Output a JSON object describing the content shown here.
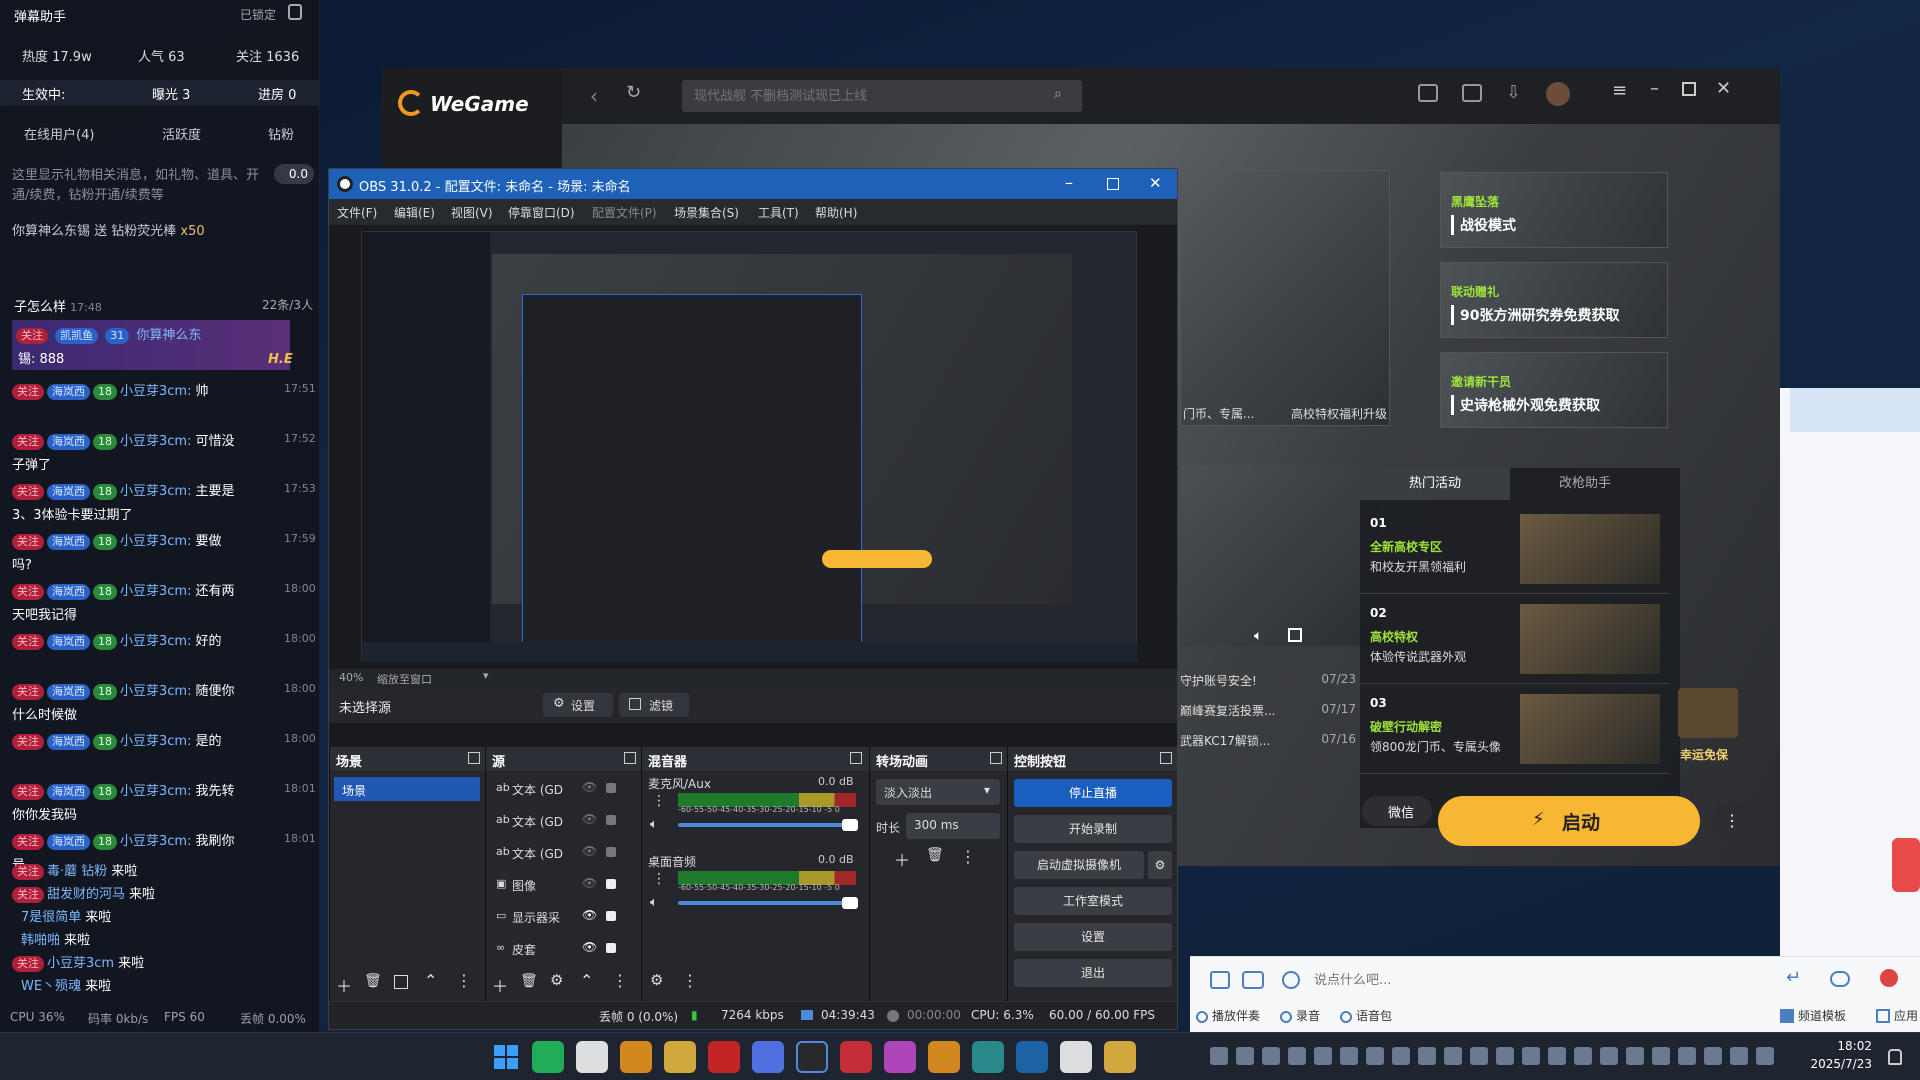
{
  "danmaku": {
    "title": "弹幕助手",
    "lock": "已锁定",
    "stats": {
      "hot": "热度 17.9w",
      "pop": "人气 63",
      "follow": "关注 1636"
    },
    "effect": {
      "active": "生效中:",
      "exposure": "曝光 3",
      "enter": "进房 0"
    },
    "header_cols": {
      "online": "在线用户(4)",
      "active": "活跃度",
      "diamond": "钻粉"
    },
    "gift_notice": "这里显示礼物相关消息，如礼物、道具、开通/续费，钻粉开通/续费等",
    "gift_count": "0.0",
    "gift_line": "你算神么东锡 送 钻粉荧光棒",
    "gift_qty": "x50",
    "chat_head": "子怎么样",
    "chat_head_time": "17:48",
    "chat_stat": "22条/3人",
    "pinned": {
      "follow": "关注",
      "fan": "凯凯鱼",
      "lv": "31",
      "name": "你算神么东",
      "text": "锡: 888"
    },
    "rows": [
      {
        "follow": "关注",
        "fan": "海岚西",
        "lv": "18",
        "name": "小豆芽3cm:",
        "text": "帅",
        "time": "17:51",
        "cont": ""
      },
      {
        "follow": "关注",
        "fan": "海岚西",
        "lv": "18",
        "name": "小豆芽3cm:",
        "text": "可惜没",
        "time": "17:52",
        "cont": "子弹了"
      },
      {
        "follow": "关注",
        "fan": "海岚西",
        "lv": "18",
        "name": "小豆芽3cm:",
        "text": "主要是",
        "time": "17:53",
        "cont": "3、3体验卡要过期了"
      },
      {
        "follow": "关注",
        "fan": "海岚西",
        "lv": "18",
        "name": "小豆芽3cm:",
        "text": "要做",
        "time": "17:59",
        "cont": "吗?"
      },
      {
        "follow": "关注",
        "fan": "海岚西",
        "lv": "18",
        "name": "小豆芽3cm:",
        "text": "还有两",
        "time": "18:00",
        "cont": "天吧我记得"
      },
      {
        "follow": "关注",
        "fan": "海岚西",
        "lv": "18",
        "name": "小豆芽3cm:",
        "text": "好的",
        "time": "18:00",
        "cont": ""
      },
      {
        "follow": "关注",
        "fan": "海岚西",
        "lv": "18",
        "name": "小豆芽3cm:",
        "text": "随便你",
        "time": "18:00",
        "cont": "什么时候做"
      },
      {
        "follow": "关注",
        "fan": "海岚西",
        "lv": "18",
        "name": "小豆芽3cm:",
        "text": "是的",
        "time": "18:00",
        "cont": ""
      },
      {
        "follow": "关注",
        "fan": "海岚西",
        "lv": "18",
        "name": "小豆芽3cm:",
        "text": "我先转",
        "time": "18:01",
        "cont": "你你发我码"
      },
      {
        "follow": "关注",
        "fan": "海岚西",
        "lv": "18",
        "name": "小豆芽3cm:",
        "text": "我刷你",
        "time": "18:01",
        "cont": "号"
      }
    ],
    "enter": [
      {
        "tag": "关注",
        "name": "毒·蘑 钻粉",
        "text": "来啦"
      },
      {
        "tag": "关注",
        "name": "甜发财的河马",
        "text": "来啦"
      },
      {
        "tag": "",
        "name": "7是很简单",
        "text": "来啦"
      },
      {
        "tag": "",
        "name": "韩啪啪",
        "text": "来啦"
      },
      {
        "tag": "关注",
        "name": "小豆芽3cm",
        "text": "来啦"
      },
      {
        "tag": "",
        "name": "WE丶殒魂",
        "text": "来啦"
      }
    ],
    "footer": {
      "cpu": "CPU 36%",
      "rate": "码率 0kb/s",
      "fps": "FPS 60",
      "drop": "丢帧 0.00%"
    }
  },
  "wegame": {
    "logo": "WeGame",
    "search_placeholder": "现代战舰 不删档测试现已上线",
    "cards": [
      {
        "tag": "黑鹰坠落",
        "title": "战役模式"
      },
      {
        "tag": "联动赠礼",
        "title": "90张方洲研究券免费获取"
      },
      {
        "tag": "邀请新干员",
        "title": "史诗枪械外观免费获取"
      }
    ],
    "hero_caption_left": "门币、专属...",
    "hero_caption_right": "高校特权福利升级",
    "tabs": {
      "hot": "热门活动",
      "helper": "改枪助手"
    },
    "events": [
      {
        "no": "01",
        "title": "全新高校专区",
        "desc": "和校友开黑领福利"
      },
      {
        "no": "02",
        "title": "高校特权",
        "desc": "体验传说武器外观"
      },
      {
        "no": "03",
        "title": "破壁行动解密",
        "desc": "领800龙门币、专属头像"
      }
    ],
    "news": [
      {
        "text": "守护账号安全!",
        "date": "07/23"
      },
      {
        "text": "巅峰赛复活投票...",
        "date": "07/17"
      },
      {
        "text": "武器KC17解锁...",
        "date": "07/16"
      }
    ],
    "lucky": "幸运免保",
    "wechat": "微信",
    "launch": "启动"
  },
  "obs": {
    "title": "OBS 31.0.2 - 配置文件: 未命名 - 场景: 未命名",
    "menu": [
      "文件(F)",
      "编辑(E)",
      "视图(V)",
      "停靠窗口(D)",
      "配置文件(P)",
      "场景集合(S)",
      "工具(T)",
      "帮助(H)"
    ],
    "zoom": "40%",
    "zoom_mode": "缩放至窗口",
    "no_source": "未选择源",
    "settings_btn": "设置",
    "filter_btn": "滤镜",
    "docks": {
      "scenes": "场景",
      "sources": "源",
      "mixer": "混音器",
      "transitions": "转场动画",
      "controls": "控制按钮"
    },
    "scene_item": "场景",
    "sources": [
      "文本 (GD",
      "文本 (GD",
      "文本 (GD",
      "图像",
      "显示器采",
      "皮套"
    ],
    "mixer": [
      {
        "name": "麦克风/Aux",
        "db": "0.0 dB"
      },
      {
        "name": "桌面音频",
        "db": "0.0 dB"
      }
    ],
    "meter_ticks": "-60-55-50-45-40-35-30-25-20-15-10 -5  0",
    "transition": "淡入淡出",
    "duration_label": "时长",
    "duration": "300 ms",
    "controls": [
      "停止直播",
      "开始录制",
      "启动虚拟摄像机",
      "工作室模式",
      "设置",
      "退出"
    ],
    "status": {
      "drop": "丢帧 0 (0.0%)",
      "kbps": "7264 kbps",
      "live": "04:39:43",
      "rec": "00:00:00",
      "cpu": "CPU: 6.3%",
      "fps": "60.00 / 60.00 FPS"
    }
  },
  "chatbar": {
    "placeholder": "说点什么吧...",
    "tools": [
      "播放伴奏",
      "录音",
      "语音包"
    ],
    "template": "频道模板",
    "apps": "应用"
  },
  "taskbar": {
    "time": "18:02",
    "date": "2025/7/23"
  },
  "colors": {
    "accent": "#f7b733",
    "obs_blue": "#1d62b8",
    "follow": "#b0203a",
    "fan": "#2a62c9"
  }
}
